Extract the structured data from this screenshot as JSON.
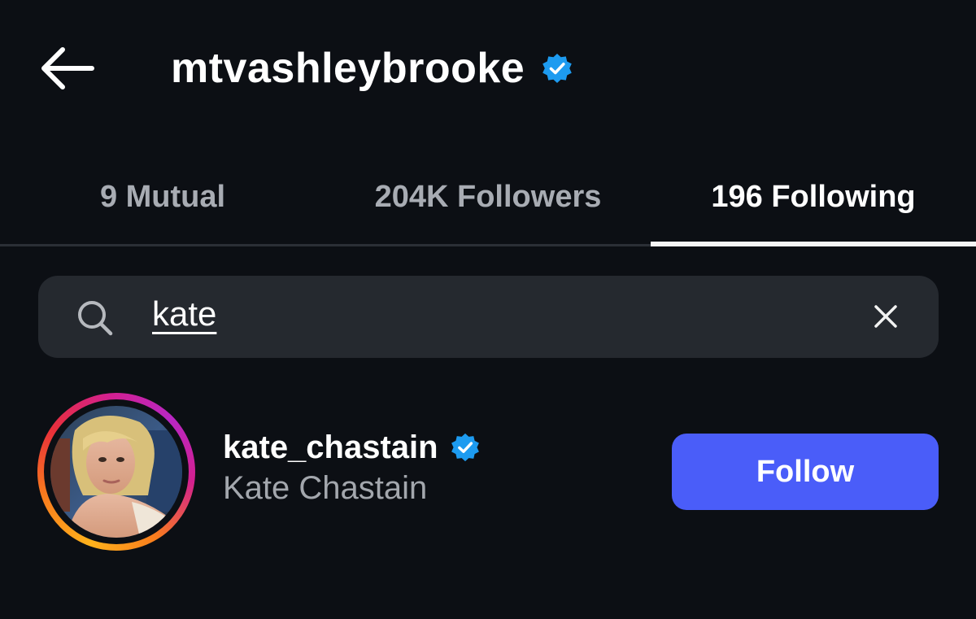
{
  "header": {
    "title": "mtvashleybrooke",
    "back_icon": "arrow-left-icon",
    "verified_icon": "verified-badge-icon"
  },
  "tabs": [
    {
      "label": "9 Mutual",
      "active": false
    },
    {
      "label": "204K Followers",
      "active": false
    },
    {
      "label": "196 Following",
      "active": true
    }
  ],
  "search": {
    "value": "kate",
    "search_icon": "search-icon",
    "clear_icon": "close-icon"
  },
  "results": [
    {
      "username": "kate_chastain",
      "full_name": "Kate Chastain",
      "verified": true,
      "button_label": "Follow"
    }
  ],
  "colors": {
    "background": "#0c0f14",
    "search_bg": "#25292f",
    "follow_button": "#4a5df9",
    "verified_blue": "#1d9bf0",
    "inactive_tab": "#a8acb3",
    "secondary_text": "#a3a7ad"
  }
}
